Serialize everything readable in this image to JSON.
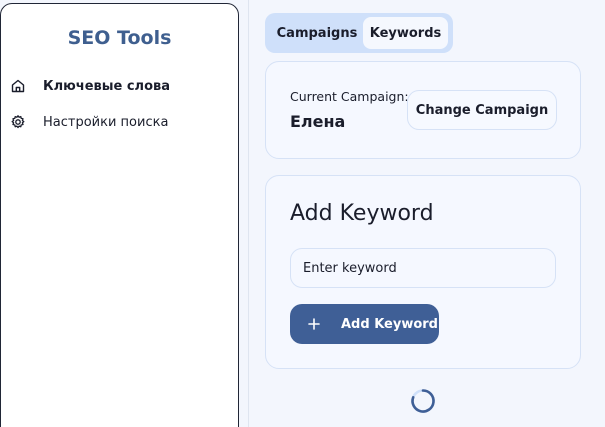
{
  "sidebar": {
    "title": "SEO Tools",
    "items": [
      {
        "label": "Ключевые слова",
        "icon": "home-icon",
        "active": true
      },
      {
        "label": "Настройки поиска",
        "icon": "gear-icon",
        "active": false
      }
    ]
  },
  "tabs": [
    {
      "label": "Campaigns",
      "active": false
    },
    {
      "label": "Keywords",
      "active": true
    }
  ],
  "campaign": {
    "label": "Current Campaign:",
    "name": "Елена",
    "change_button": "Change Campaign"
  },
  "add_keyword": {
    "title": "Add Keyword",
    "input_placeholder": "Enter keyword",
    "input_value": "",
    "button": "Add Keyword"
  },
  "colors": {
    "accent": "#3f5f96",
    "sidebar_title": "#3f5f8f",
    "tabs_bg": "#cfe0fa",
    "card_bg": "#f5f8ff",
    "card_border": "#d6e2f6"
  },
  "status": {
    "loading_icon": "spinner-icon"
  }
}
